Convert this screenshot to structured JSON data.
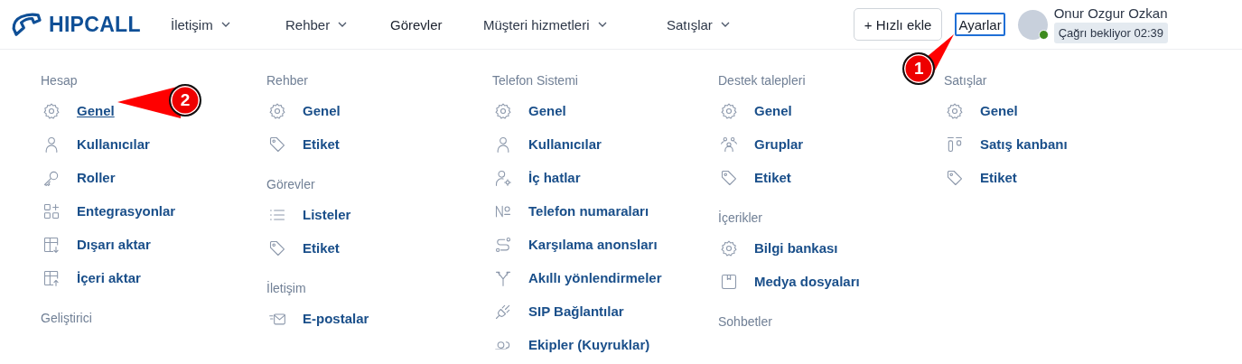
{
  "header": {
    "logo": "HIPCALL",
    "nav": [
      {
        "label": "İletişim",
        "dropdown": true
      },
      {
        "label": "Rehber",
        "dropdown": true
      },
      {
        "label": "Görevler",
        "dropdown": false
      },
      {
        "label": "Müşteri hizmetleri",
        "dropdown": true
      },
      {
        "label": "Satışlar",
        "dropdown": true
      }
    ],
    "buttons": [
      {
        "label": "+ Hızlı ekle",
        "kind": "outlined",
        "focused": false
      },
      {
        "label": "Ayarlar",
        "kind": "plain",
        "focused": true,
        "callout": "1"
      }
    ],
    "user": {
      "name": "Onur Ozgur Ozkan",
      "status": "Çağrı bekliyor 02:39",
      "online": true
    }
  },
  "columns": [
    {
      "sections": [
        {
          "heading": "Hesap",
          "items": [
            {
              "label": "Genel",
              "kind": "gear",
              "focused": true,
              "callout": "2"
            },
            {
              "label": "Kullanıcılar",
              "kind": "user",
              "focused": false
            },
            {
              "label": "Roller",
              "kind": "key",
              "focused": false
            },
            {
              "label": "Entegrasyonlar",
              "kind": "apps",
              "focused": false
            },
            {
              "label": "Dışarı aktar",
              "kind": "export",
              "focused": false
            },
            {
              "label": "İçeri aktar",
              "kind": "import",
              "focused": false
            }
          ]
        },
        {
          "heading": "Geliştirici"
        }
      ]
    },
    {
      "sections": [
        {
          "heading": "Rehber",
          "items": [
            {
              "label": "Genel",
              "kind": "gear",
              "focused": false
            },
            {
              "label": "Etiket",
              "kind": "tag",
              "focused": false
            }
          ]
        },
        {
          "heading": "Görevler",
          "items": [
            {
              "label": "Listeler",
              "kind": "list",
              "focused": false
            },
            {
              "label": "Etiket",
              "kind": "tag",
              "focused": false
            }
          ]
        },
        {
          "heading": "İletişim",
          "items": [
            {
              "label": "E-postalar",
              "kind": "mail",
              "focused": false
            }
          ]
        }
      ]
    },
    {
      "sections": [
        {
          "heading": "Telefon Sistemi",
          "items": [
            {
              "label": "Genel",
              "kind": "gear",
              "focused": false
            },
            {
              "label": "Kullanıcılar",
              "kind": "user",
              "focused": false
            },
            {
              "label": "İç hatlar",
              "kind": "usergear",
              "focused": false
            },
            {
              "label": "Telefon numaraları",
              "kind": "numero",
              "focused": false
            },
            {
              "label": "Karşılama anonsları",
              "kind": "route",
              "focused": false
            },
            {
              "label": "Akıllı yönlendirmeler",
              "kind": "split",
              "focused": false
            },
            {
              "label": "SIP Bağlantılar",
              "kind": "plug",
              "focused": false
            },
            {
              "label": "Ekipler (Kuyruklar)",
              "kind": "team",
              "focused": false
            }
          ]
        }
      ]
    },
    {
      "sections": [
        {
          "heading": "Destek talepleri",
          "items": [
            {
              "label": "Genel",
              "kind": "gear",
              "focused": false
            },
            {
              "label": "Gruplar",
              "kind": "group",
              "focused": false
            },
            {
              "label": "Etiket",
              "kind": "tag",
              "focused": false
            }
          ]
        },
        {
          "heading": "İçerikler",
          "items": [
            {
              "label": "Bilgi bankası",
              "kind": "gear",
              "focused": false
            },
            {
              "label": "Medya dosyaları",
              "kind": "media",
              "focused": false
            }
          ]
        },
        {
          "heading": "Sohbetler"
        }
      ]
    },
    {
      "sections": [
        {
          "heading": "Satışlar",
          "items": [
            {
              "label": "Genel",
              "kind": "gear",
              "focused": false
            },
            {
              "label": "Satış kanbanı",
              "kind": "kanban",
              "focused": false
            },
            {
              "label": "Etiket",
              "kind": "tag",
              "focused": false
            }
          ]
        }
      ]
    }
  ]
}
